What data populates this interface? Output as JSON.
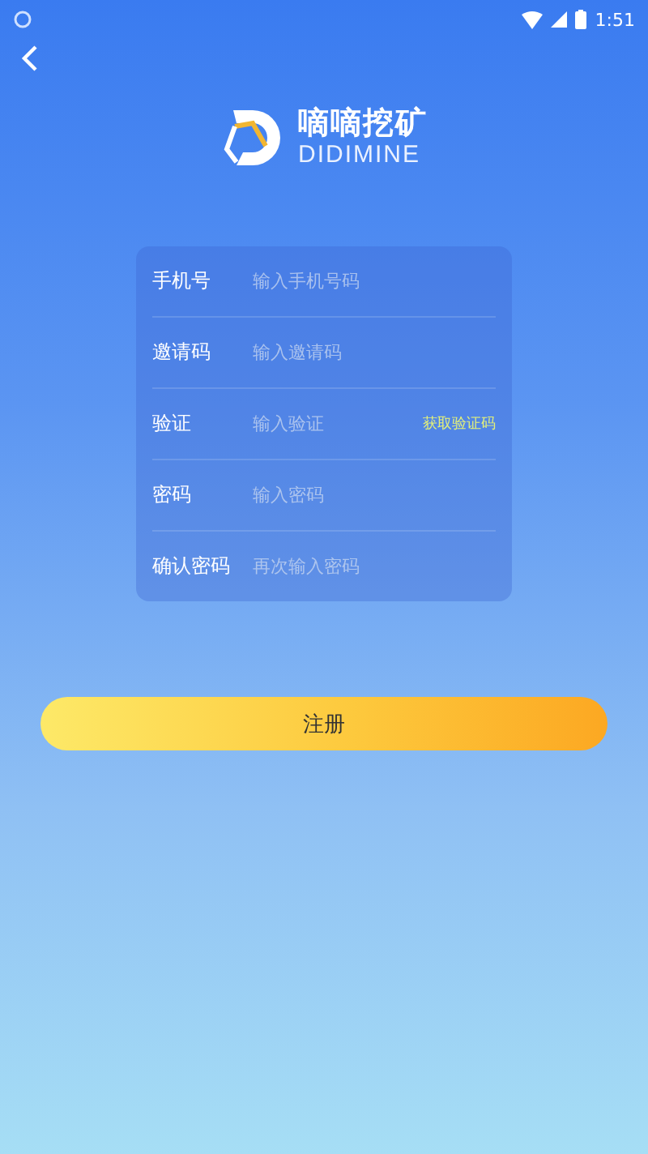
{
  "status_bar": {
    "time": "1:51"
  },
  "logo": {
    "title": "嘀嘀挖矿",
    "subtitle": "DIDIMINE"
  },
  "form": {
    "fields": [
      {
        "label": "手机号",
        "placeholder": "输入手机号码"
      },
      {
        "label": "邀请码",
        "placeholder": "输入邀请码"
      },
      {
        "label": "验证",
        "placeholder": "输入验证",
        "action": "获取验证码"
      },
      {
        "label": "密码",
        "placeholder": "输入密码"
      },
      {
        "label": "确认密码",
        "placeholder": "再次输入密码"
      }
    ]
  },
  "submit_button": {
    "label": "注册"
  }
}
